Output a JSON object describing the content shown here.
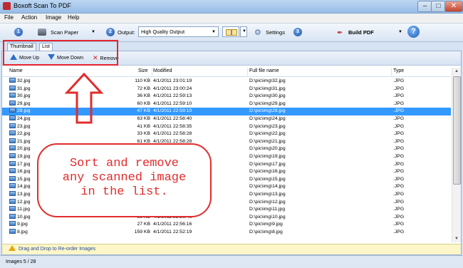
{
  "window": {
    "title": "Boxoft Scan To PDF"
  },
  "menu": [
    "File",
    "Action",
    "Image",
    "Help"
  ],
  "toolbar": {
    "step1": "1",
    "scan_paper": "Scan Paper",
    "step2": "2",
    "output_label": "Output:",
    "output_value": "High Quality Output",
    "settings": "Settings",
    "step3": "3",
    "build_pdf": "Build PDF",
    "help": "?"
  },
  "tabs": [
    "Thumbnail",
    "List"
  ],
  "listbar": {
    "move_up": "Move Up",
    "move_down": "Move Down",
    "remove": "Remove"
  },
  "columns": [
    "Name",
    "Size",
    "Modified",
    "Full file name",
    "Type"
  ],
  "rows": [
    [
      "32.jpg",
      "110 KB",
      "4/1/2011 23:01:19",
      "D:\\pic\\img\\32.jpg",
      ".JPG"
    ],
    [
      "31.jpg",
      "72 KB",
      "4/1/2011 23:00:24",
      "D:\\pic\\img\\31.jpg",
      ".JPG"
    ],
    [
      "30.jpg",
      "36 KB",
      "4/1/2011 22:59:13",
      "D:\\pic\\img\\30.jpg",
      ".JPG"
    ],
    [
      "29.jpg",
      "60 KB",
      "4/1/2011 22:59:10",
      "D:\\pic\\img\\29.jpg",
      ".JPG"
    ],
    [
      "28.jpg",
      "47 KB",
      "4/1/2011 22:59:10",
      "D:\\pic\\img\\28.jpg",
      ".JPG"
    ],
    [
      "24.jpg",
      "63 KB",
      "4/1/2011 22:58:40",
      "D:\\pic\\img\\24.jpg",
      ".JPG"
    ],
    [
      "23.jpg",
      "41 KB",
      "4/1/2011 22:58:35",
      "D:\\pic\\img\\23.jpg",
      ".JPG"
    ],
    [
      "22.jpg",
      "33 KB",
      "4/1/2011 22:58:28",
      "D:\\pic\\img\\22.jpg",
      ".JPG"
    ],
    [
      "21.jpg",
      "61 KB",
      "4/1/2011 22:58:28",
      "D:\\pic\\img\\21.jpg",
      ".JPG"
    ],
    [
      "20.jpg",
      "",
      "",
      "D:\\pic\\img\\20.jpg",
      ".JPG"
    ],
    [
      "19.jpg",
      "",
      "",
      "D:\\pic\\img\\19.jpg",
      ".JPG"
    ],
    [
      "17.jpg",
      "",
      "",
      "D:\\pic\\img\\17.jpg",
      ".JPG"
    ],
    [
      "16.jpg",
      "",
      "",
      "D:\\pic\\img\\16.jpg",
      ".JPG"
    ],
    [
      "15.jpg",
      "",
      "",
      "D:\\pic\\img\\15.jpg",
      ".JPG"
    ],
    [
      "14.jpg",
      "",
      "",
      "D:\\pic\\img\\14.jpg",
      ".JPG"
    ],
    [
      "13.jpg",
      "",
      "",
      "D:\\pic\\img\\13.jpg",
      ".JPG"
    ],
    [
      "12.jpg",
      "114 KB",
      "4/1/2011 22:57:03",
      "D:\\pic\\img\\12.jpg",
      ".JPG"
    ],
    [
      "11.jpg",
      "60 KB",
      "4/1/2011 22:56:47",
      "D:\\pic\\img\\11.jpg",
      ".JPG"
    ],
    [
      "10.jpg",
      "58 KB",
      "4/1/2011 22:56:46",
      "D:\\pic\\img\\10.jpg",
      ".JPG"
    ],
    [
      "9.jpg",
      "27 KB",
      "4/1/2011 22:56:16",
      "D:\\pic\\img\\9.jpg",
      ".JPG"
    ],
    [
      "8.jpg",
      "159 KB",
      "4/1/2011 22:52:19",
      "D:\\pic\\img\\8.jpg",
      ".JPG"
    ]
  ],
  "selected_row": 4,
  "hint": "Drag and Drop to Re-order Images",
  "status": "Images 5 / 28",
  "callout": {
    "line1": "Sort and remove",
    "line2": "any scanned image",
    "line3": "in the list."
  },
  "colors": {
    "selection": "#3399ff",
    "annotation": "#e22c2c",
    "pdf_icon": "#c1282d"
  }
}
